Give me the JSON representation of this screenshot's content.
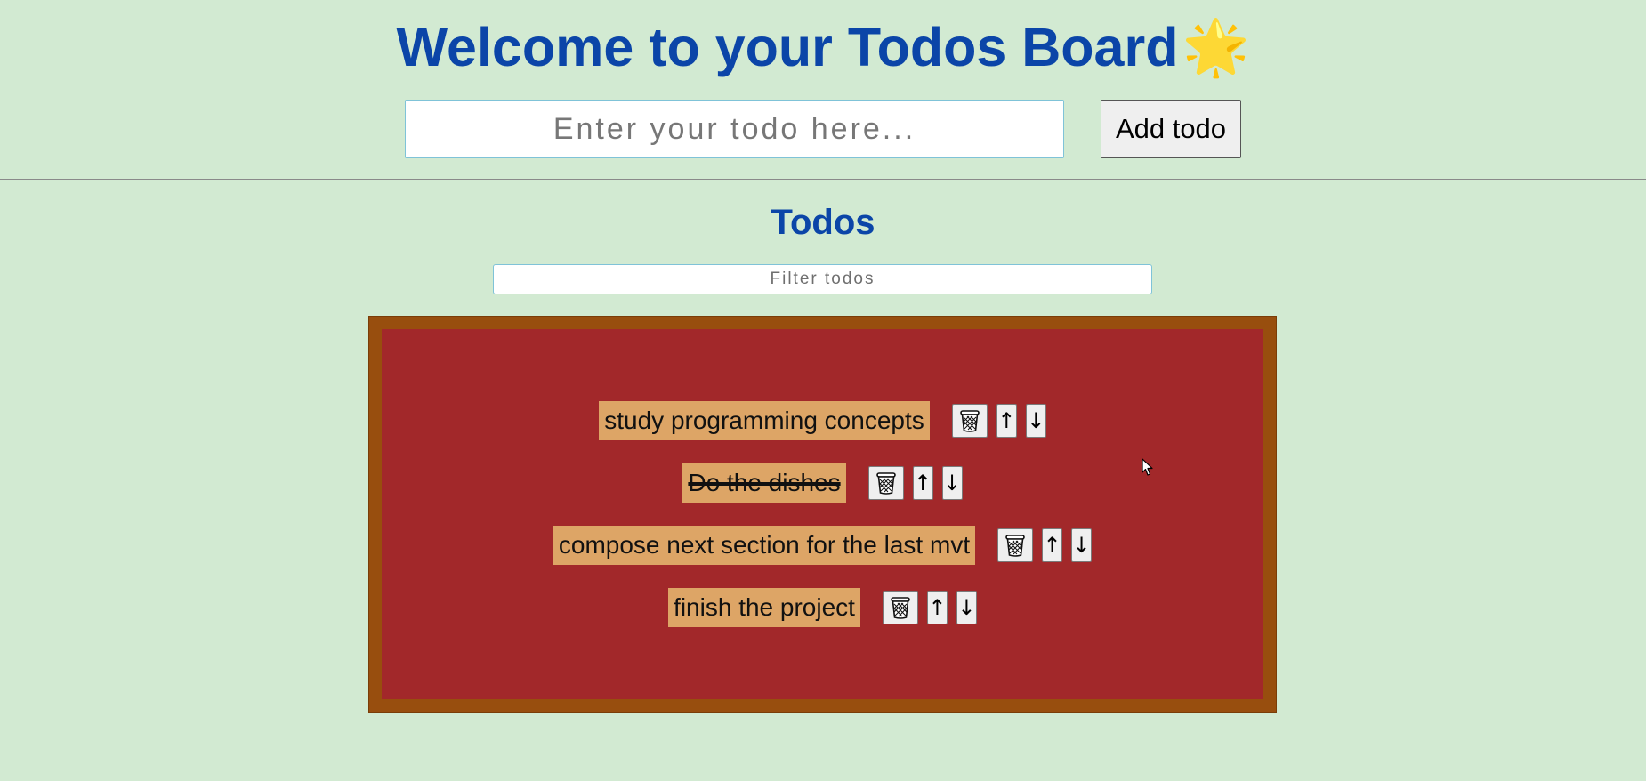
{
  "header": {
    "title": "Welcome to your Todos Board",
    "title_emoji": "🌟",
    "input_placeholder": "Enter your todo here...",
    "add_button_label": "Add todo"
  },
  "todos_section": {
    "heading": "Todos",
    "filter_placeholder": "Filter todos",
    "items": [
      {
        "text": "study programming concepts",
        "completed": false
      },
      {
        "text": "Do the dishes",
        "completed": true
      },
      {
        "text": "compose next section for the last mvt",
        "completed": false
      },
      {
        "text": "finish the project",
        "completed": false
      }
    ],
    "up_label": "↑",
    "down_label": "↓"
  },
  "icons": {
    "delete": "wastebasket-icon",
    "cursor": "mouse-pointer-icon"
  },
  "colors": {
    "background": "#d2ead2",
    "heading": "#0b45a8",
    "board_frame": "#984e0e",
    "board": "#a2282a",
    "todo_chip": "#dda566"
  }
}
